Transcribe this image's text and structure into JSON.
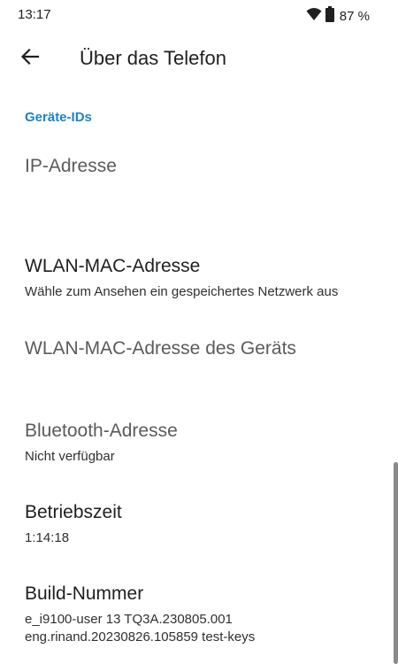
{
  "status_bar": {
    "time": "13:17",
    "battery_text": "87 %",
    "icons": [
      "wifi-icon",
      "battery-icon"
    ]
  },
  "app_bar": {
    "title": "Über das Telefon",
    "back_icon": "arrow-left-icon"
  },
  "section": {
    "header": "Geräte-IDs",
    "accent_color": "#1b83c8"
  },
  "items": [
    {
      "title": "IP-Adresse",
      "summary": ""
    },
    {
      "title": "WLAN-MAC-Adresse",
      "summary": "Wähle zum Ansehen ein gespeichertes Netzwerk aus"
    },
    {
      "title": "WLAN-MAC-Adresse des Geräts",
      "summary": ""
    },
    {
      "title": "Bluetooth-Adresse",
      "summary": "Nicht verfügbar"
    },
    {
      "title": "Betriebszeit",
      "summary": "1:14:18"
    },
    {
      "title": "Build-Nummer",
      "summary_line1": "e_i9100-user 13 TQ3A.230805.001",
      "summary_line2": "eng.rinand.20230826.105859 test-keys"
    }
  ]
}
